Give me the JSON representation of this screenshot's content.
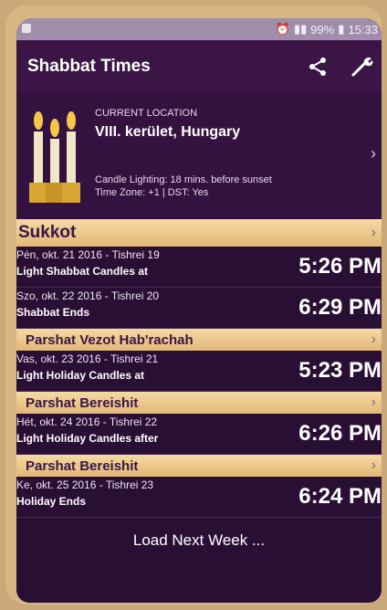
{
  "status": {
    "battery": "99%",
    "time": "15:33"
  },
  "app": {
    "title": "Shabbat Times"
  },
  "location": {
    "caption": "CURRENT LOCATION",
    "name": "VIII. kerület, Hungary",
    "candle_lighting": "Candle Lighting: 18 mins. before sunset",
    "timezone": "Time Zone: +1 | DST: Yes"
  },
  "sections": [
    {
      "title": "Sukkot",
      "rows": [
        {
          "date": "Pén, okt. 21 2016 - Tishrei 19",
          "desc": "Light Shabbat Candles at",
          "time": "5:26 PM"
        },
        {
          "date": "Szo, okt. 22 2016 - Tishrei 20",
          "desc": "Shabbat Ends",
          "time": "6:29 PM"
        }
      ]
    },
    {
      "title": "Parshat Vezot Hab'rachah",
      "rows": [
        {
          "date": "Vas, okt. 23 2016 - Tishrei 21",
          "desc": "Light Holiday Candles at",
          "time": "5:23 PM"
        }
      ]
    },
    {
      "title": "Parshat Bereishit",
      "rows": [
        {
          "date": "Hét, okt. 24 2016 - Tishrei 22",
          "desc": "Light Holiday Candles after",
          "time": "6:26 PM"
        }
      ]
    },
    {
      "title": "Parshat Bereishit",
      "rows": [
        {
          "date": "Ke, okt. 25 2016 - Tishrei 23",
          "desc": "Holiday Ends",
          "time": "6:24 PM"
        }
      ]
    }
  ],
  "footer": {
    "load_next": "Load Next Week ..."
  },
  "colors": {
    "accent": "#3a1546",
    "band": "#f5d9a4",
    "candle_flame": "#f6c64a"
  }
}
